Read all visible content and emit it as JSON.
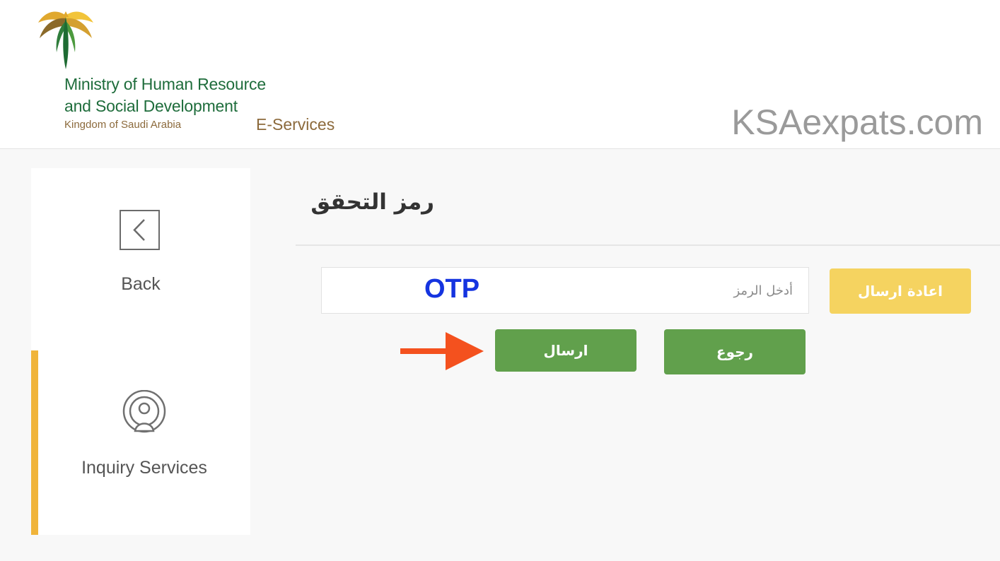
{
  "header": {
    "ministry_line1": "Ministry of Human Resource",
    "ministry_line2": "and Social Development",
    "kingdom": "Kingdom of Saudi Arabia",
    "eservices": "E-Services",
    "watermark": "KSAexpats.com"
  },
  "sidebar": {
    "items": [
      {
        "label": "Back",
        "icon": "chevron-left-icon"
      },
      {
        "label": "Inquiry Services",
        "icon": "person-signal-icon",
        "active": true
      }
    ]
  },
  "main": {
    "title": "رمز التحقق",
    "otp_placeholder": "أدخل الرمز",
    "otp_overlay": "OTP",
    "buttons": {
      "resend": "اعادة ارسال",
      "send": "ارسال",
      "back": "رجوع"
    }
  },
  "colors": {
    "green": "#61a04c",
    "yellow": "#f5d360",
    "active_bar": "#f0b43a",
    "arrow": "#f4511e",
    "overlay_text": "#1534e0"
  }
}
